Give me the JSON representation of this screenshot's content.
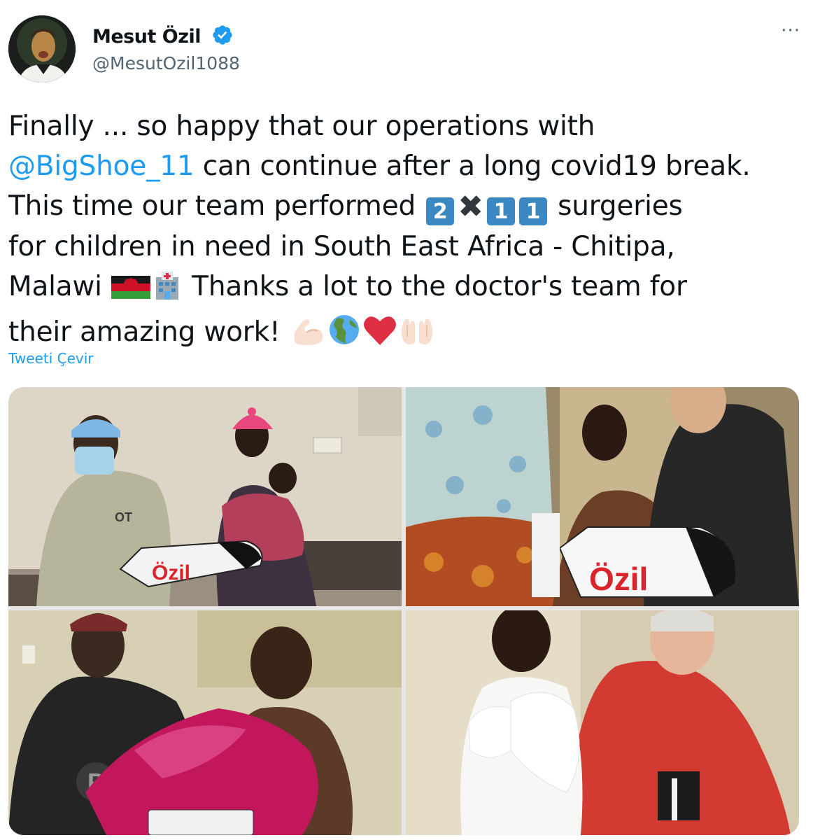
{
  "author": {
    "display_name": "Mesut Özil",
    "handle": "@MesutOzil1088",
    "verified": true
  },
  "more_label": "···",
  "tweet": {
    "line1": "Finally ... so happy that our operations with",
    "mention": "@BigShoe_11",
    "line2_rest": " can continue after a long covid19 break.",
    "line3_start": "This time our team performed ",
    "keycap_digits": [
      "2",
      "1",
      "1"
    ],
    "times_symbol": "✖",
    "line3_end": " surgeries",
    "line4": "for children in need in South East Africa - Chitipa,",
    "line5_start": "Malawi ",
    "line5_end": " Thanks a lot to the doctor's team for",
    "line6": "their amazing work! "
  },
  "emojis": [
    "malawi-flag",
    "hospital",
    "flexed-biceps",
    "globe-americas",
    "red-heart",
    "raising-hands"
  ],
  "translate_label": "Tweeti Çevir",
  "media": {
    "count": 4,
    "shoe_brand_text": "Özil",
    "shirt_text_1": "OT",
    "shirt_text_2": "P",
    "accent_red": "#d8242a"
  },
  "colors": {
    "link": "#1d9bf0",
    "secondary_text": "#536471",
    "verified_badge": "#1d9bf0"
  }
}
